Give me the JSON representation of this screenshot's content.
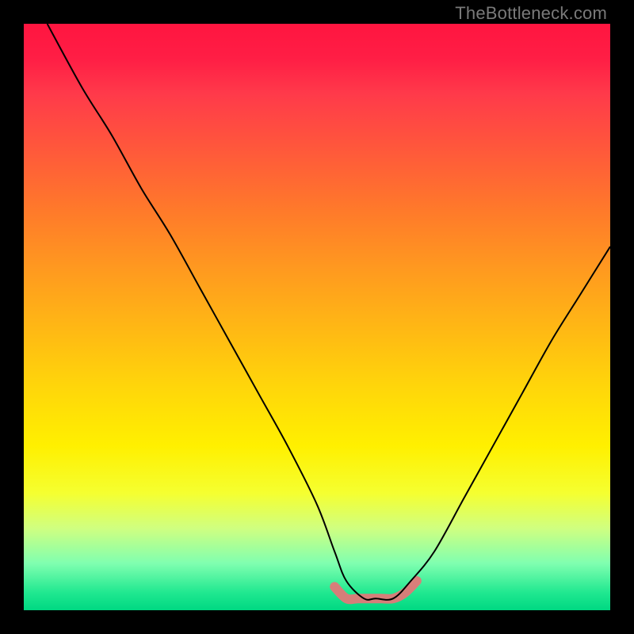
{
  "watermark": "TheBottleneck.com",
  "colors": {
    "background": "#000000",
    "curve": "#000000",
    "highlight": "#e07878",
    "gradient_top": "#ff1540",
    "gradient_bottom": "#00d882"
  },
  "chart_data": {
    "type": "line",
    "title": "",
    "xlabel": "",
    "ylabel": "",
    "xlim": [
      0,
      100
    ],
    "ylim": [
      0,
      100
    ],
    "grid": false,
    "legend": false,
    "annotations": [
      "TheBottleneck.com"
    ],
    "series": [
      {
        "name": "bottleneck-curve",
        "x": [
          4,
          10,
          15,
          20,
          25,
          30,
          35,
          40,
          45,
          50,
          53,
          55,
          58,
          60,
          63,
          66,
          70,
          75,
          80,
          85,
          90,
          95,
          100
        ],
        "y": [
          100,
          89,
          81,
          72,
          64,
          55,
          46,
          37,
          28,
          18,
          10,
          5,
          2,
          2,
          2,
          5,
          10,
          19,
          28,
          37,
          46,
          54,
          62
        ]
      },
      {
        "name": "optimal-range-highlight",
        "x": [
          53,
          55,
          57,
          59,
          61,
          63,
          65,
          67
        ],
        "y": [
          4,
          2,
          2,
          2,
          2,
          2,
          3,
          5
        ]
      }
    ]
  }
}
